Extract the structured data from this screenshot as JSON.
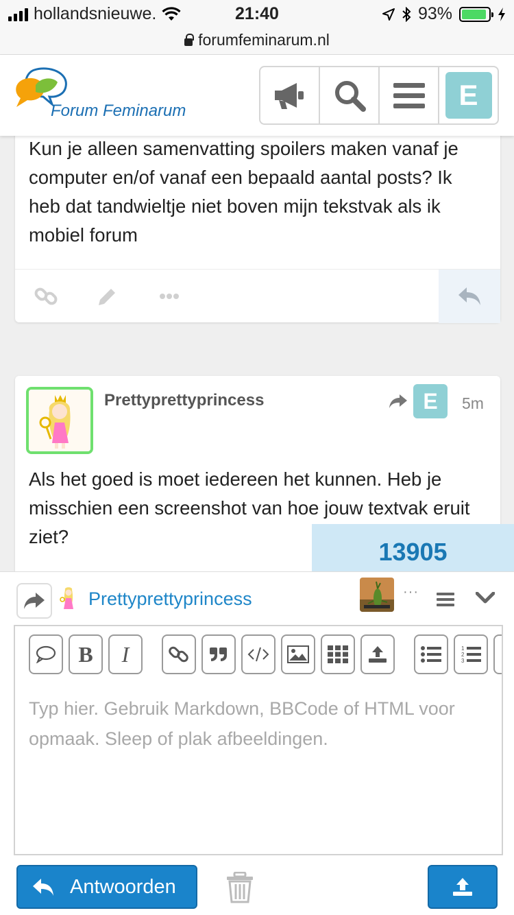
{
  "status_bar": {
    "carrier": "hollandsnieuwe.",
    "time": "21:40",
    "battery": "93%",
    "battery_level": 0.93
  },
  "browser": {
    "url": "forumfeminarum.nl"
  },
  "header": {
    "site_name": "Forum Feminarum",
    "user_initial": "E",
    "icons": [
      "megaphone-icon",
      "search-icon",
      "hamburger-icon"
    ]
  },
  "posts": [
    {
      "text": "Kun je alleen samenvatting spoilers maken vanaf je computer en/of vanaf een bepaald aantal posts? Ik heb dat tandwieltje niet boven mijn tekstvak als ik mobiel forum",
      "actions": [
        "link-icon",
        "pencil-icon",
        "more-icon",
        "reply-icon"
      ]
    },
    {
      "username": "Prettyprettyprincess",
      "reply_to_initial": "E",
      "time": "5m",
      "text": "Als het goed is moet iedereen het kunnen. Heb je misschien een screenshot van hoe jouw textvak eruit ziet?"
    }
  ],
  "counter": "13905",
  "composer": {
    "reply_target": "Prettyprettyprincess",
    "placeholder": "Typ hier. Gebruik Markdown, BBCode of HTML voor opmaak. Sleep of plak afbeeldingen.",
    "toolbar": [
      "quote-icon",
      "bold-icon",
      "italic-icon",
      "link-icon",
      "blockquote-icon",
      "code-icon",
      "image-icon",
      "table-icon",
      "upload-icon",
      "bullet-list-icon",
      "numbered-list-icon",
      "emoji-icon"
    ],
    "bold_label": "B",
    "italic_label": "I",
    "submit_label": "Antwoorden"
  },
  "colors": {
    "accent": "#1a84cb",
    "avatar_e": "#8fd0d5",
    "highlight": "#cfe8f6",
    "avatar_border": "#6fe06f"
  }
}
